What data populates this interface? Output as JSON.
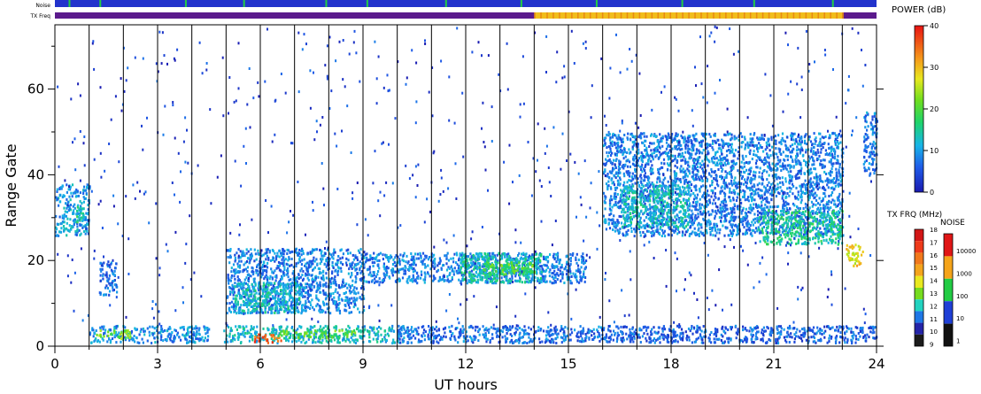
{
  "chart_data": [
    {
      "type": "heatmap",
      "title": "",
      "xlabel": "UT hours",
      "ylabel": "Range Gate",
      "xlim": [
        0,
        24
      ],
      "ylim": [
        0,
        75
      ],
      "xticks": [
        "0",
        "3",
        "6",
        "9",
        "12",
        "15",
        "18",
        "21",
        "24"
      ],
      "yticks": [
        "0",
        "20",
        "40",
        "60"
      ],
      "hour_lines": [
        1,
        2,
        3,
        4,
        5,
        6,
        7,
        8,
        9,
        10,
        11,
        12,
        13,
        14,
        15,
        16,
        17,
        18,
        19,
        20,
        21,
        22,
        23
      ],
      "grid": false,
      "series": [
        {
          "name": "POWER (dB)",
          "segments": [
            {
              "x": [
                0,
                1
              ],
              "y": [
                26,
                38
              ],
              "level": 10
            },
            {
              "x": [
                0.6,
                0.8
              ],
              "y": [
                29,
                33
              ],
              "level": 16
            },
            {
              "x": [
                1.3,
                1.8
              ],
              "y": [
                12,
                20
              ],
              "level": 7
            },
            {
              "x": [
                1,
                4.5
              ],
              "y": [
                1,
                5
              ],
              "level": 9
            },
            {
              "x": [
                1.2,
                2.2
              ],
              "y": [
                2,
                4
              ],
              "level": 22
            },
            {
              "x": [
                4.9,
                10.2
              ],
              "y": [
                1,
                5
              ],
              "level": 12
            },
            {
              "x": [
                5.8,
                6.6
              ],
              "y": [
                1,
                3
              ],
              "level": 35
            },
            {
              "x": [
                6.5,
                8.8
              ],
              "y": [
                2,
                4
              ],
              "level": 20
            },
            {
              "x": [
                5,
                9
              ],
              "y": [
                8,
                23
              ],
              "level": 8
            },
            {
              "x": [
                5.2,
                7.2
              ],
              "y": [
                8,
                15
              ],
              "level": 13
            },
            {
              "x": [
                9,
                15.5
              ],
              "y": [
                15,
                22
              ],
              "level": 8
            },
            {
              "x": [
                11.8,
                14.2
              ],
              "y": [
                15,
                22
              ],
              "level": 14
            },
            {
              "x": [
                12.5,
                14
              ],
              "y": [
                17,
                20
              ],
              "level": 20
            },
            {
              "x": [
                10,
                16
              ],
              "y": [
                1,
                5
              ],
              "level": 7
            },
            {
              "x": [
                16,
                23
              ],
              "y": [
                26,
                50
              ],
              "level": 8
            },
            {
              "x": [
                16.5,
                18.5
              ],
              "y": [
                28,
                38
              ],
              "level": 13
            },
            {
              "x": [
                20.5,
                23
              ],
              "y": [
                24,
                32
              ],
              "level": 15
            },
            {
              "x": [
                23.1,
                23.6
              ],
              "y": [
                19,
                24
              ],
              "level": 28
            },
            {
              "x": [
                23.6,
                24
              ],
              "y": [
                40,
                55
              ],
              "level": 8
            },
            {
              "x": [
                16,
                24
              ],
              "y": [
                1,
                5
              ],
              "level": 6
            }
          ]
        }
      ],
      "colorbar": {
        "power": {
          "label": "POWER (dB)",
          "ticks": [
            "0",
            "10",
            "20",
            "30",
            "40"
          ]
        },
        "tx_frq": {
          "label": "TX FRQ (MHz)",
          "ticks": [
            "18",
            "17",
            "16",
            "15",
            "14",
            "13",
            "12",
            "11",
            "10",
            "9"
          ]
        },
        "noise": {
          "label": "NOISE",
          "ticks": [
            "10000",
            "1000",
            "100",
            "10",
            "1"
          ]
        }
      },
      "strips": {
        "noise": {
          "label": "Noise",
          "color": "#2233cc",
          "tick_color": "#22cc44"
        },
        "tx_freq": {
          "label": "TX Freq",
          "low_color": "#5b1a8c",
          "high_color": "#f1bd1c",
          "high_start_hour": 14,
          "high_end_hour": 23
        }
      }
    }
  ]
}
